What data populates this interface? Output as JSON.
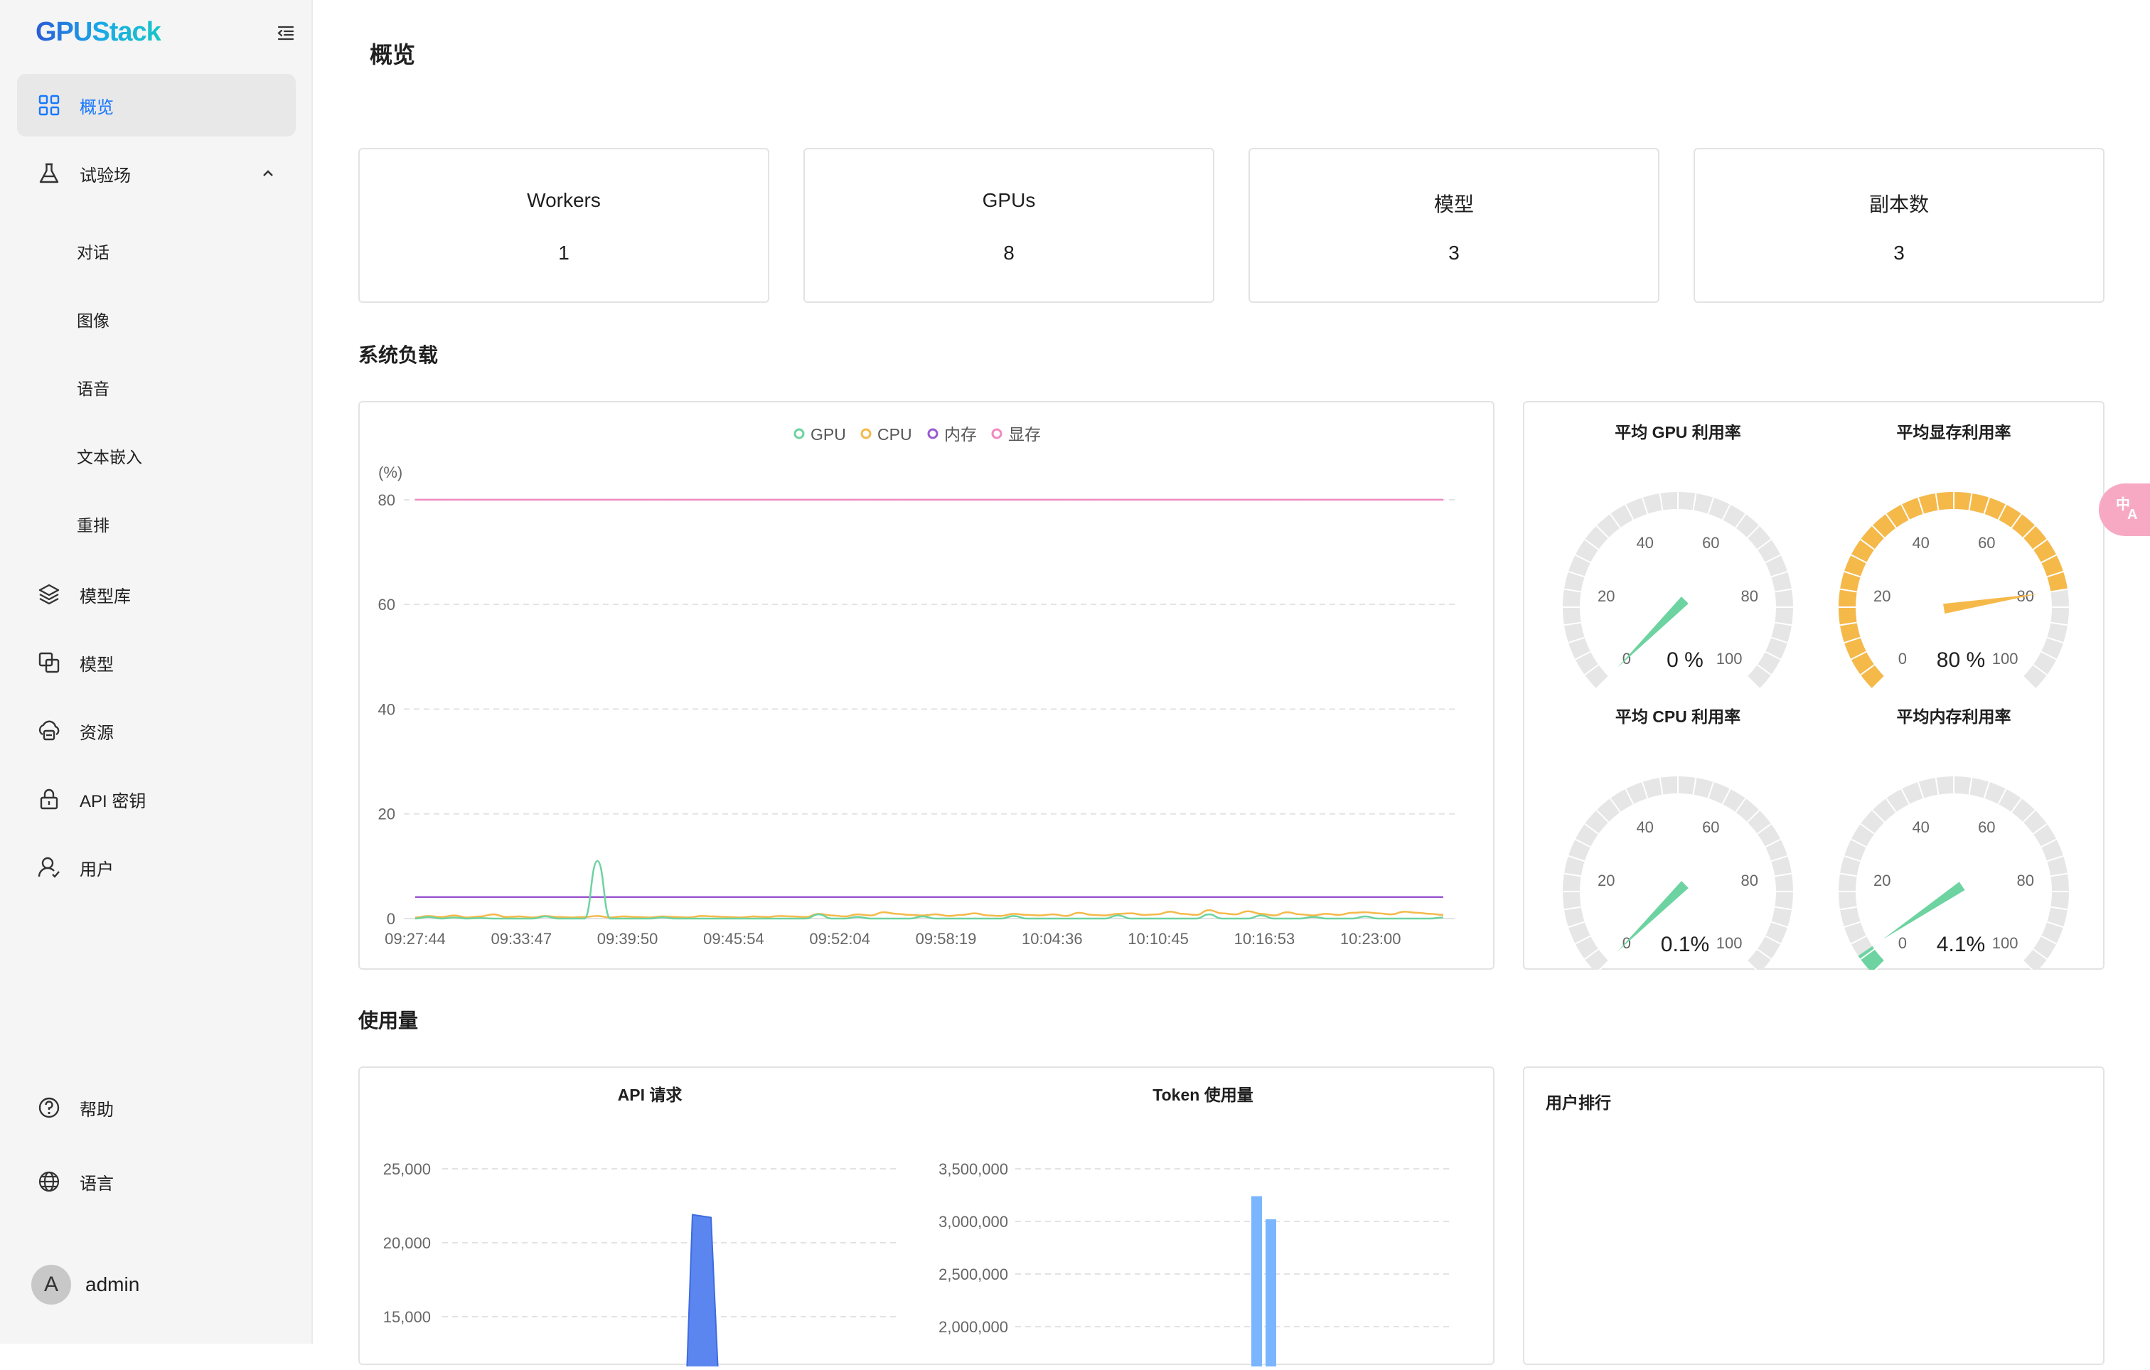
{
  "app": {
    "logo": "GPUStack"
  },
  "sidebar": {
    "items": [
      {
        "label": "概览",
        "icon": "dashboard-icon",
        "active": true
      },
      {
        "label": "试验场",
        "icon": "flask-icon",
        "expanded": true
      },
      {
        "label": "模型库",
        "icon": "layers-icon"
      },
      {
        "label": "模型",
        "icon": "copy-icon"
      },
      {
        "label": "资源",
        "icon": "cloud-server-icon"
      },
      {
        "label": "API 密钥",
        "icon": "lock-icon"
      },
      {
        "label": "用户",
        "icon": "user-icon"
      }
    ],
    "playground_sub": [
      "对话",
      "图像",
      "语音",
      "文本嵌入",
      "重排"
    ],
    "bottom": [
      {
        "label": "帮助",
        "icon": "question-icon"
      },
      {
        "label": "语言",
        "icon": "globe-icon"
      }
    ],
    "user": {
      "avatar_letter": "A",
      "name": "admin"
    }
  },
  "page": {
    "title": "概览"
  },
  "stats": [
    {
      "label": "Workers",
      "value": "1"
    },
    {
      "label": "GPUs",
      "value": "8"
    },
    {
      "label": "模型",
      "value": "3"
    },
    {
      "label": "副本数",
      "value": "3"
    }
  ],
  "sections": {
    "system_load": "系统负载",
    "usage": "使用量"
  },
  "gauges": [
    {
      "title": "平均 GPU 利用率",
      "value": 0,
      "display": "0 %",
      "color": "#6dd3a0"
    },
    {
      "title": "平均显存利用率",
      "value": 80,
      "display": "80 %",
      "color": "#f5b94a"
    },
    {
      "title": "平均 CPU 利用率",
      "value": 0.1,
      "display": "0.1%",
      "color": "#6dd3a0"
    },
    {
      "title": "平均内存利用率",
      "value": 4.1,
      "display": "4.1%",
      "color": "#6dd3a0"
    }
  ],
  "gauge_ticks": [
    "0",
    "20",
    "40",
    "60",
    "80",
    "100"
  ],
  "user_rank": {
    "title": "用户排行"
  },
  "colors": {
    "accent": "#1677ff",
    "gpu": "#6dd3a0",
    "cpu": "#f5b94a",
    "memory": "#9b59d0",
    "vram": "#f08ac0",
    "bar": "#7ab6ff",
    "area": "#5b86f0"
  },
  "chart_data": [
    {
      "type": "line",
      "unit_label": "(%)",
      "ylim": [
        0,
        85
      ],
      "yticks": [
        0,
        20,
        40,
        60,
        80
      ],
      "x_tick_labels": [
        "09:27:44",
        "09:33:47",
        "09:39:50",
        "09:45:54",
        "09:52:04",
        "09:58:19",
        "10:04:36",
        "10:10:45",
        "10:16:53",
        "10:23:00"
      ],
      "legend": "top-center",
      "grid": true,
      "series": [
        {
          "name": "GPU",
          "color": "#6dd3a0",
          "values": [
            0,
            0.3,
            0,
            0.2,
            0,
            0.1,
            0,
            0,
            0,
            0,
            0.4,
            0,
            0,
            0,
            11,
            0,
            0,
            0,
            0,
            0.2,
            0,
            0,
            0,
            0,
            0,
            0,
            0,
            0,
            0,
            0,
            0,
            0.8,
            0,
            0,
            0.3,
            0,
            0,
            0,
            0,
            0.4,
            0,
            0,
            0,
            0,
            0,
            0,
            0.5,
            0,
            0,
            0,
            0,
            0,
            0,
            0,
            0.6,
            0,
            0,
            0,
            0,
            0,
            0,
            0.8,
            0,
            0,
            0,
            0.6,
            0,
            0,
            0,
            0.3,
            0,
            0,
            0,
            0.4,
            0,
            0,
            0,
            0,
            0,
            0.2
          ]
        },
        {
          "name": "CPU",
          "color": "#f5b94a",
          "values": [
            0.2,
            0.5,
            0.3,
            0.6,
            0.2,
            0.4,
            0.8,
            0.3,
            0.4,
            0.2,
            0.5,
            0.3,
            0.2,
            0.3,
            0.5,
            0.2,
            0.4,
            0.3,
            0.2,
            0.4,
            0.3,
            0.2,
            0.5,
            0.4,
            0.3,
            0.2,
            0.4,
            0.3,
            0.5,
            0.4,
            0.3,
            0.9,
            0.6,
            0.4,
            0.8,
            0.6,
            1.2,
            0.9,
            0.7,
            0.6,
            0.8,
            0.5,
            0.7,
            1.0,
            0.6,
            0.5,
            0.9,
            0.7,
            0.6,
            0.8,
            0.5,
            1.1,
            0.7,
            0.6,
            0.9,
            1.0,
            0.7,
            0.8,
            1.3,
            0.9,
            0.7,
            1.6,
            1.0,
            0.8,
            1.4,
            0.9,
            0.6,
            1.2,
            0.8,
            0.6,
            0.9,
            0.7,
            1.1,
            1.2,
            1.0,
            0.8,
            1.3,
            1.1,
            0.9,
            0.7
          ]
        },
        {
          "name": "内存",
          "color": "#9b59d0",
          "values": [
            4.1,
            4.1,
            4.1,
            4.1,
            4.1,
            4.1,
            4.1,
            4.1,
            4.1,
            4.1
          ]
        },
        {
          "name": "显存",
          "color": "#f08ac0",
          "values": [
            80,
            80,
            80,
            80,
            80,
            80,
            80,
            80,
            80,
            80
          ]
        }
      ]
    },
    {
      "type": "area",
      "title": "API 请求",
      "yticks": [
        15000,
        20000,
        25000
      ],
      "ytick_labels": [
        "15,000",
        "20,000",
        "25,000"
      ],
      "ylim": [
        11000,
        26500
      ],
      "peak": {
        "x_index": 1,
        "value": 21900
      },
      "grid": true
    },
    {
      "type": "bar",
      "title": "Token 使用量",
      "yticks": [
        2000000,
        2500000,
        3000000,
        3500000
      ],
      "ytick_labels": [
        "2,000,000",
        "2,500,000",
        "3,000,000",
        "3,500,000"
      ],
      "ylim": [
        1600000,
        3700000
      ],
      "values": [
        3240000,
        3020000
      ],
      "grid": true
    }
  ]
}
